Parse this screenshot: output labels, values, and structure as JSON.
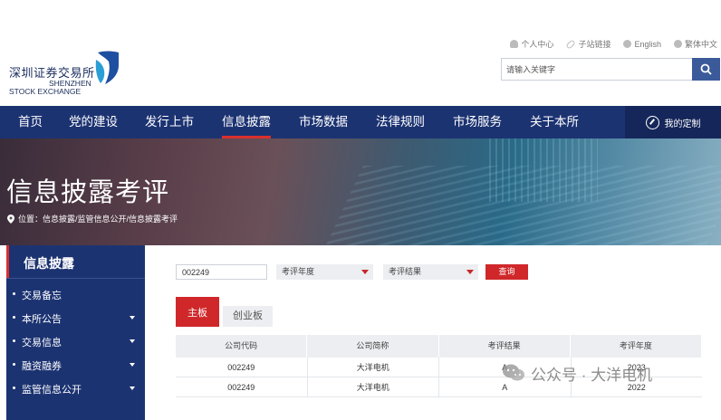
{
  "header": {
    "logo": {
      "cn": "深圳证券交易所",
      "en_line1": "SHENZHEN",
      "en_line2": "STOCK EXCHANGE"
    },
    "top_links": [
      {
        "label": "个人中心",
        "icon": "person-icon"
      },
      {
        "label": "子站链接",
        "icon": "link-icon"
      },
      {
        "label": "English",
        "icon": "globe-icon"
      },
      {
        "label": "繁体中文",
        "icon": "globe-icon"
      }
    ],
    "search": {
      "placeholder": "请输入关键字",
      "icon": "search-icon"
    }
  },
  "nav": {
    "items": [
      {
        "label": "首页"
      },
      {
        "label": "党的建设"
      },
      {
        "label": "发行上市"
      },
      {
        "label": "信息披露",
        "active": true
      },
      {
        "label": "市场数据"
      },
      {
        "label": "法律规则"
      },
      {
        "label": "市场服务"
      },
      {
        "label": "关于本所"
      }
    ],
    "custom_label": "我的定制"
  },
  "banner": {
    "title": "信息披露考评",
    "breadcrumb": "位置：信息披露/监管信息公开/信息披露考评"
  },
  "sidebar": {
    "title": "信息披露",
    "items": [
      {
        "label": "交易备忘",
        "expandable": false
      },
      {
        "label": "本所公告",
        "expandable": true
      },
      {
        "label": "交易信息",
        "expandable": true
      },
      {
        "label": "融资融券",
        "expandable": true
      },
      {
        "label": "监管信息公开",
        "expandable": true
      }
    ]
  },
  "filter": {
    "code_value": "002249",
    "year_placeholder": "考评年度",
    "result_placeholder": "考评结果",
    "query_label": "查询",
    "accent": "#d0282a"
  },
  "tabs": [
    {
      "label": "主板",
      "active": true
    },
    {
      "label": "创业板",
      "active": false
    }
  ],
  "table": {
    "headers": [
      "公司代码",
      "公司简称",
      "考评结果",
      "考评年度"
    ],
    "rows": [
      [
        "002249",
        "大洋电机",
        "A",
        "2023"
      ],
      [
        "002249",
        "大洋电机",
        "A",
        "2022"
      ]
    ]
  },
  "watermark": {
    "text": "公众号 · 大洋电机"
  },
  "colors": {
    "nav_bg": "#1c3372",
    "active_red": "#d9302c"
  }
}
